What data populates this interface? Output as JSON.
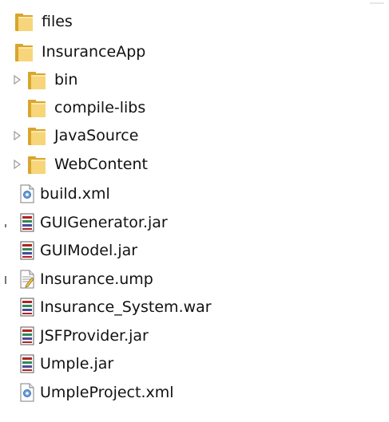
{
  "tree": {
    "items": [
      {
        "label": "files",
        "type": "folder",
        "expandable": false,
        "icon": "folder-icon"
      },
      {
        "label": "InsuranceApp",
        "type": "folder",
        "expandable": false,
        "icon": "folder-icon"
      },
      {
        "label": "bin",
        "type": "folder",
        "expandable": true,
        "icon": "folder-icon"
      },
      {
        "label": "compile-libs",
        "type": "folder",
        "expandable": false,
        "icon": "folder-icon"
      },
      {
        "label": "JavaSource",
        "type": "folder",
        "expandable": true,
        "icon": "folder-icon"
      },
      {
        "label": "WebContent",
        "type": "folder",
        "expandable": true,
        "icon": "folder-icon"
      },
      {
        "label": "build.xml",
        "type": "file",
        "icon": "xml-file-icon"
      },
      {
        "label": "GUIGenerator.jar",
        "type": "file",
        "icon": "jar-file-icon"
      },
      {
        "label": "GUIModel.jar",
        "type": "file",
        "icon": "jar-file-icon"
      },
      {
        "label": "Insurance.ump",
        "type": "file",
        "icon": "text-file-icon"
      },
      {
        "label": "Insurance_System.war",
        "type": "file",
        "icon": "jar-file-icon"
      },
      {
        "label": "JSFProvider.jar",
        "type": "file",
        "icon": "jar-file-icon"
      },
      {
        "label": "Umple.jar",
        "type": "file",
        "icon": "jar-file-icon"
      },
      {
        "label": "UmpleProject.xml",
        "type": "file",
        "icon": "xml-file-icon"
      }
    ]
  },
  "colors": {
    "folder_light": "#f7d57a",
    "folder_dark": "#d9a52c",
    "expander_arrow": "#9a9a9a",
    "jar_red": "#b22222",
    "jar_green": "#2e8b57",
    "xml_blue": "#2f6fb1"
  }
}
